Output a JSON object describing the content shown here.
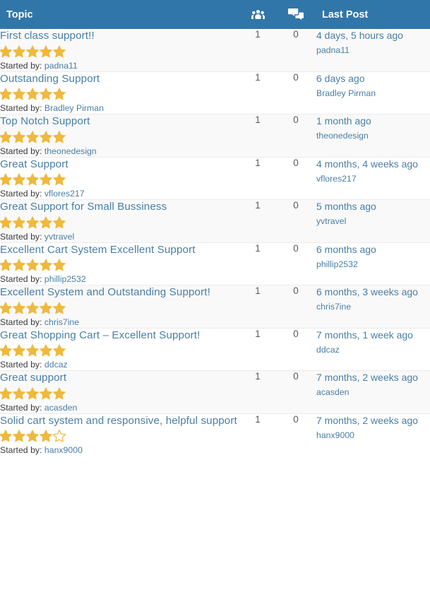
{
  "header": {
    "topic_label": "Topic",
    "voices_icon": "users-group-icon",
    "replies_icon": "speech-bubbles-icon",
    "last_post_label": "Last Post",
    "background_color": "#3176a8",
    "text_color": "#ffffff"
  },
  "style": {
    "link_color": "#4a7fa5",
    "star_color": "#efb93d",
    "row_alt_background": "#f9f9f9",
    "row_background": "#ffffff",
    "row_border_color": "#ececec"
  },
  "labels": {
    "started_by_prefix": "Started by:"
  },
  "topics": [
    {
      "title": "First class support!!",
      "rating": 5,
      "max_rating": 5,
      "author": "padna11",
      "voices": "1",
      "replies": "0",
      "last_post_date": "4 days, 5 hours ago",
      "last_post_author": "padna11"
    },
    {
      "title": "Outstanding Support",
      "rating": 5,
      "max_rating": 5,
      "author": "Bradley Pirman",
      "voices": "1",
      "replies": "0",
      "last_post_date": "6 days ago",
      "last_post_author": "Bradley Pirman"
    },
    {
      "title": "Top Notch Support",
      "rating": 5,
      "max_rating": 5,
      "author": "theonedesign",
      "voices": "1",
      "replies": "0",
      "last_post_date": "1 month ago",
      "last_post_author": "theonedesign"
    },
    {
      "title": "Great Support",
      "rating": 5,
      "max_rating": 5,
      "author": "vflores217",
      "voices": "1",
      "replies": "0",
      "last_post_date": "4 months, 4 weeks ago",
      "last_post_author": "vflores217"
    },
    {
      "title": "Great Support for Small Bussiness",
      "rating": 5,
      "max_rating": 5,
      "author": "yvtravel",
      "voices": "1",
      "replies": "0",
      "last_post_date": "5 months ago",
      "last_post_author": "yvtravel"
    },
    {
      "title": "Excellent Cart System Excellent Support",
      "rating": 5,
      "max_rating": 5,
      "author": "phillip2532",
      "voices": "1",
      "replies": "0",
      "last_post_date": "6 months ago",
      "last_post_author": "phillip2532"
    },
    {
      "title": "Excellent System and Outstanding Support!",
      "rating": 5,
      "max_rating": 5,
      "author": "chris7ine",
      "voices": "1",
      "replies": "0",
      "last_post_date": "6 months, 3 weeks ago",
      "last_post_author": "chris7ine"
    },
    {
      "title": "Great Shopping Cart – Excellent Support!",
      "rating": 5,
      "max_rating": 5,
      "author": "ddcaz",
      "voices": "1",
      "replies": "0",
      "last_post_date": "7 months, 1 week ago",
      "last_post_author": "ddcaz"
    },
    {
      "title": "Great support",
      "rating": 5,
      "max_rating": 5,
      "author": "acasden",
      "voices": "1",
      "replies": "0",
      "last_post_date": "7 months, 2 weeks ago",
      "last_post_author": "acasden"
    },
    {
      "title": "Solid cart system and responsive, helpful support",
      "rating": 4,
      "max_rating": 5,
      "author": "hanx9000",
      "voices": "1",
      "replies": "0",
      "last_post_date": "7 months, 2 weeks ago",
      "last_post_author": "hanx9000"
    }
  ]
}
